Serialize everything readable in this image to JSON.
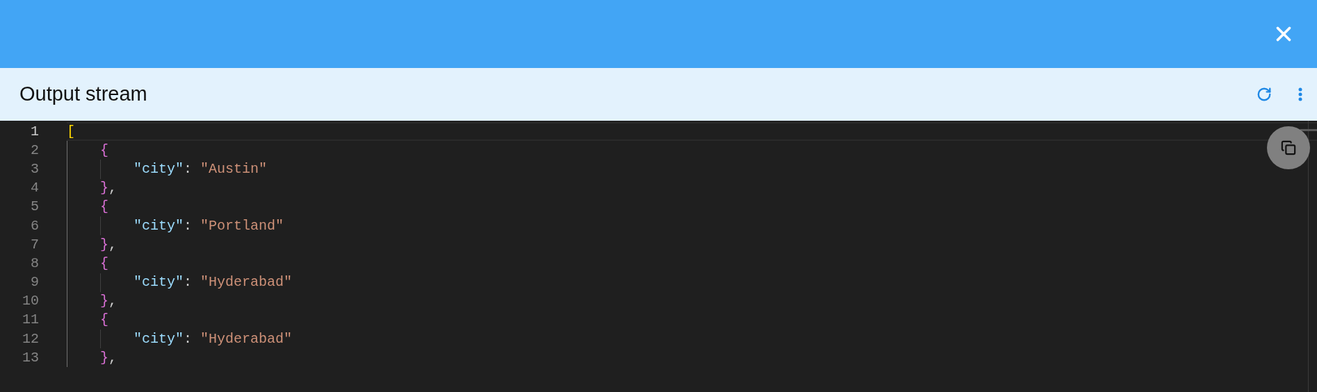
{
  "panel": {
    "title": "Output stream"
  },
  "editor": {
    "lines": [
      {
        "number": "1",
        "selected": true,
        "tokens": [
          {
            "kind": "bracket",
            "text": "["
          }
        ],
        "children": [
          {
            "number": "2",
            "selected": false,
            "tokens": [
              {
                "kind": "brace",
                "text": "{"
              }
            ],
            "children": [
              {
                "number": "3",
                "selected": false,
                "tokens": [
                  {
                    "kind": "key",
                    "text": "\"city\""
                  },
                  {
                    "kind": "punct",
                    "text": ": "
                  },
                  {
                    "kind": "string",
                    "text": "\"Austin\""
                  }
                ]
              }
            ]
          },
          {
            "number": "4",
            "selected": false,
            "tokens": [
              {
                "kind": "brace",
                "text": "}"
              },
              {
                "kind": "punct",
                "text": ","
              }
            ]
          },
          {
            "number": "5",
            "selected": false,
            "tokens": [
              {
                "kind": "brace",
                "text": "{"
              }
            ],
            "children": [
              {
                "number": "6",
                "selected": false,
                "tokens": [
                  {
                    "kind": "key",
                    "text": "\"city\""
                  },
                  {
                    "kind": "punct",
                    "text": ": "
                  },
                  {
                    "kind": "string",
                    "text": "\"Portland\""
                  }
                ]
              }
            ]
          },
          {
            "number": "7",
            "selected": false,
            "tokens": [
              {
                "kind": "brace",
                "text": "}"
              },
              {
                "kind": "punct",
                "text": ","
              }
            ]
          },
          {
            "number": "8",
            "selected": false,
            "tokens": [
              {
                "kind": "brace",
                "text": "{"
              }
            ],
            "children": [
              {
                "number": "9",
                "selected": false,
                "tokens": [
                  {
                    "kind": "key",
                    "text": "\"city\""
                  },
                  {
                    "kind": "punct",
                    "text": ": "
                  },
                  {
                    "kind": "string",
                    "text": "\"Hyderabad\""
                  }
                ]
              }
            ]
          },
          {
            "number": "10",
            "selected": false,
            "tokens": [
              {
                "kind": "brace",
                "text": "}"
              },
              {
                "kind": "punct",
                "text": ","
              }
            ]
          },
          {
            "number": "11",
            "selected": false,
            "tokens": [
              {
                "kind": "brace",
                "text": "{"
              }
            ],
            "children": [
              {
                "number": "12",
                "selected": false,
                "tokens": [
                  {
                    "kind": "key",
                    "text": "\"city\""
                  },
                  {
                    "kind": "punct",
                    "text": ": "
                  },
                  {
                    "kind": "string",
                    "text": "\"Hyderabad\""
                  }
                ]
              }
            ]
          },
          {
            "number": "13",
            "selected": false,
            "tokens": [
              {
                "kind": "brace",
                "text": "}"
              },
              {
                "kind": "punct",
                "text": ","
              }
            ]
          }
        ]
      }
    ]
  }
}
